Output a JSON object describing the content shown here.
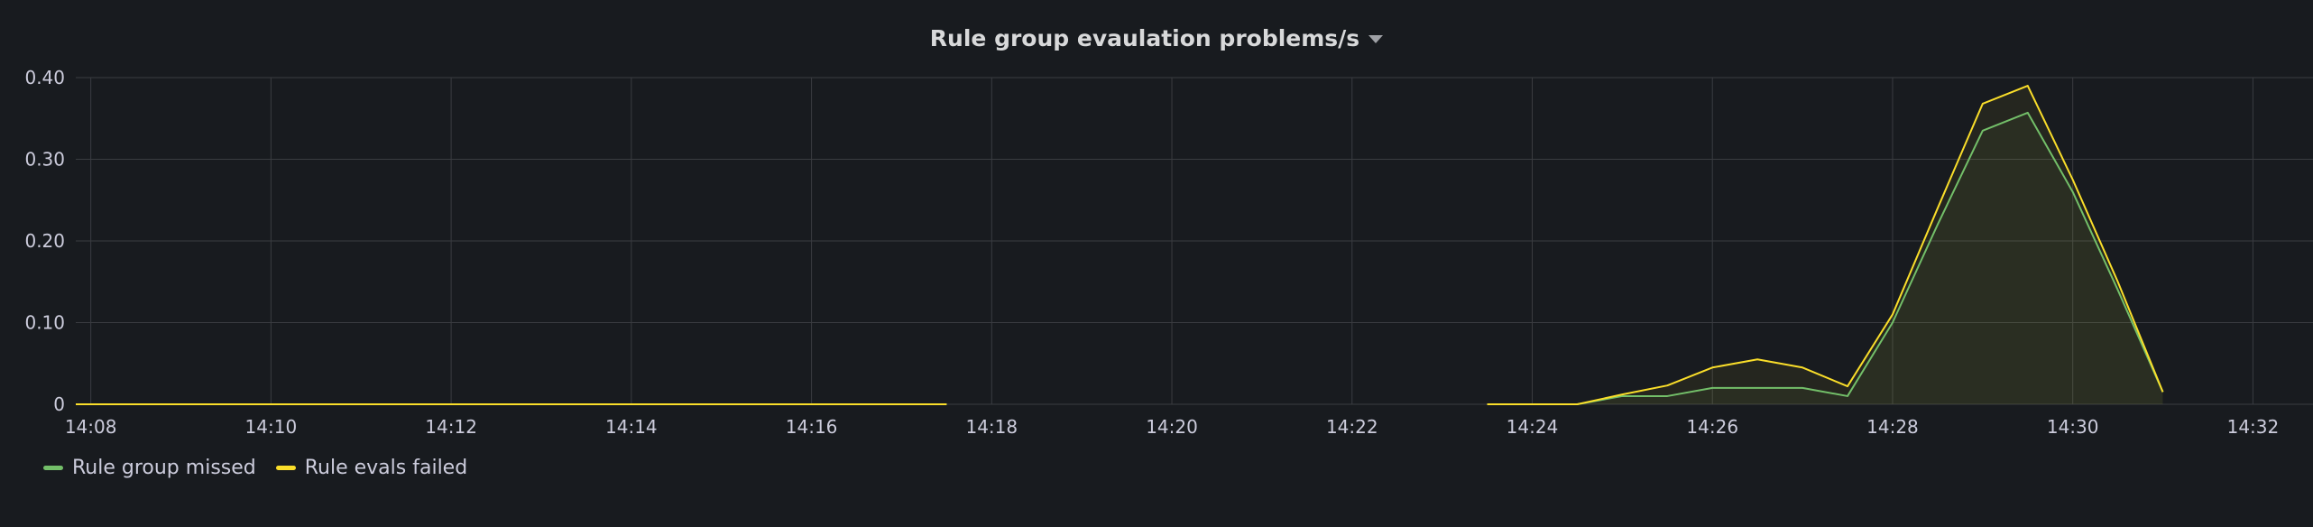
{
  "panel": {
    "title": "Rule group evaulation problems/s",
    "menu_icon": "caret-down-icon"
  },
  "colors": {
    "background": "#181b1f",
    "grid": "#3a3c41",
    "axis_text": "#ccccdc",
    "rule_group_missed": "#73bf69",
    "rule_evals_failed": "#fade2a"
  },
  "chart_data": {
    "type": "line",
    "title": "Rule group evaulation problems/s",
    "xlabel": "",
    "ylabel": "",
    "x_ticks": [
      "14:08",
      "14:10",
      "14:12",
      "14:14",
      "14:16",
      "14:18",
      "14:20",
      "14:22",
      "14:24",
      "14:26",
      "14:28",
      "14:30",
      "14:32"
    ],
    "y_ticks": [
      "0",
      "0.10",
      "0.20",
      "0.30",
      "0.40"
    ],
    "xlim": [
      "14:07:50",
      "14:32:40"
    ],
    "ylim": [
      0,
      0.4
    ],
    "grid": true,
    "legend": "bottom-left",
    "series": [
      {
        "name": "Rule group missed",
        "color": "#73bf69",
        "fill": true,
        "segments": [
          {
            "x": [
              "14:07:50",
              "14:17:30"
            ],
            "y": [
              0,
              0
            ]
          },
          {
            "x": [
              "14:23:30",
              "14:24:30",
              "14:25:00",
              "14:25:30",
              "14:26:00",
              "14:26:30",
              "14:27:00",
              "14:27:30",
              "14:28:00",
              "14:28:30",
              "14:29:00",
              "14:29:30",
              "14:30:00",
              "14:30:30",
              "14:31:00"
            ],
            "y": [
              0,
              0,
              0.01,
              0.01,
              0.02,
              0.02,
              0.02,
              0.01,
              0.1,
              0.22,
              0.335,
              0.357,
              0.26,
              0.14,
              0.015
            ]
          }
        ]
      },
      {
        "name": "Rule evals failed",
        "color": "#fade2a",
        "fill": true,
        "segments": [
          {
            "x": [
              "14:07:50",
              "14:17:30"
            ],
            "y": [
              0,
              0
            ]
          },
          {
            "x": [
              "14:23:30",
              "14:24:30",
              "14:25:00",
              "14:25:30",
              "14:26:00",
              "14:26:30",
              "14:27:00",
              "14:27:30",
              "14:28:00",
              "14:28:30",
              "14:29:00",
              "14:29:30",
              "14:30:00",
              "14:30:30",
              "14:31:00"
            ],
            "y": [
              0,
              0,
              0.012,
              0.023,
              0.045,
              0.055,
              0.045,
              0.022,
              0.11,
              0.24,
              0.368,
              0.39,
              0.275,
              0.15,
              0.015
            ]
          }
        ]
      }
    ]
  },
  "legend": {
    "items": [
      {
        "label": "Rule group missed",
        "color": "#73bf69"
      },
      {
        "label": "Rule evals failed",
        "color": "#fade2a"
      }
    ]
  }
}
